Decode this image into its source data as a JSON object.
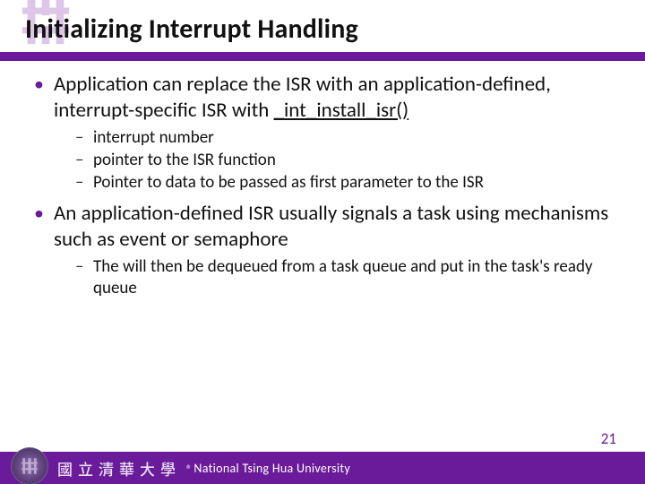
{
  "title": "Initializing Interrupt Handling",
  "bullets": {
    "b1a_pre": "Application can replace the ISR with an application-defined, interrupt-specific ISR with ",
    "b1a_fn": "_int_install_isr()",
    "b1a_sub": [
      "interrupt number",
      "pointer to the ISR function",
      "Pointer to data to be passed as first parameter to the ISR"
    ],
    "b1b": "An application-defined ISR usually signals a task using mechanisms such as event or semaphore",
    "b1b_sub": [
      "The will then be dequeued from a task queue and put in the task's ready queue"
    ]
  },
  "footer": {
    "cn": "國立清華大學",
    "en": "National Tsing Hua University"
  },
  "page": "21"
}
